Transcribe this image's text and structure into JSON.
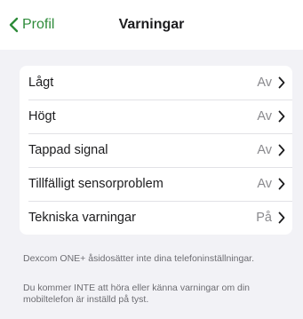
{
  "nav": {
    "back_label": "Profil",
    "title": "Varningar"
  },
  "alerts": [
    {
      "label": "Lågt",
      "value": "Av"
    },
    {
      "label": "Högt",
      "value": "Av"
    },
    {
      "label": "Tappad signal",
      "value": "Av"
    },
    {
      "label": "Tillfälligt sensorproblem",
      "value": "Av"
    },
    {
      "label": "Tekniska varningar",
      "value": "På"
    }
  ],
  "notes": {
    "override": "Dexcom ONE+ åsidosätter inte dina telefoninställningar.",
    "silent": "Du kommer INTE att höra eller känna varningar om din mobiltelefon är inställd på tyst."
  },
  "colors": {
    "accent": "#2e8b3a",
    "background": "#f2f2f6"
  }
}
